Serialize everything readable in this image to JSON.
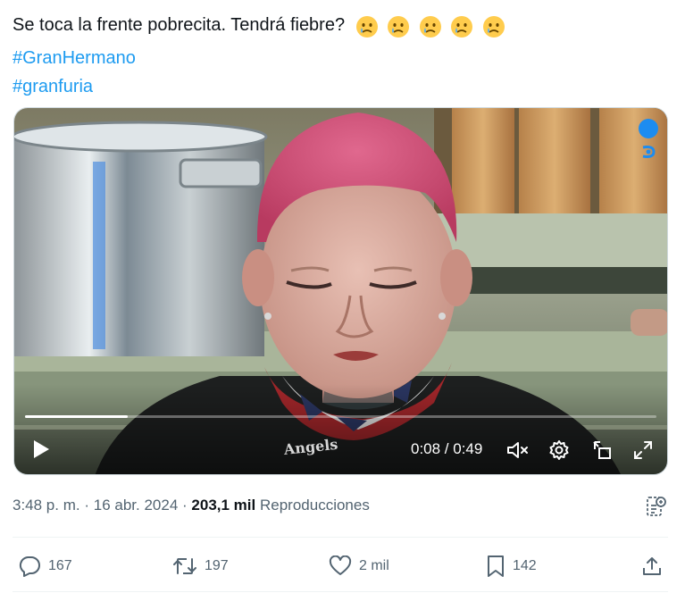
{
  "tweet": {
    "text": "Se toca la frente pobrecita. Tendrá fiebre?",
    "emojis": [
      "crying-face",
      "crying-face",
      "crying-face",
      "crying-face",
      "crying-face"
    ],
    "hashtags": [
      "#GranHermano",
      "#granfuria"
    ]
  },
  "video": {
    "time_label": "0:08 / 0:49",
    "progress": 0.163,
    "shirt_text": "Angels"
  },
  "meta": {
    "time": "3:48 p. m.",
    "sep1": "·",
    "date": "16 abr. 2024",
    "sep2": "·",
    "views_count": "203,1 mil",
    "views_label": "Reproducciones"
  },
  "actions": {
    "replies": "167",
    "retweets": "197",
    "likes": "2 mil",
    "bookmarks": "142"
  },
  "colors": {
    "link": "#1d9bf0",
    "muted": "#536471",
    "text": "#0f1419"
  }
}
